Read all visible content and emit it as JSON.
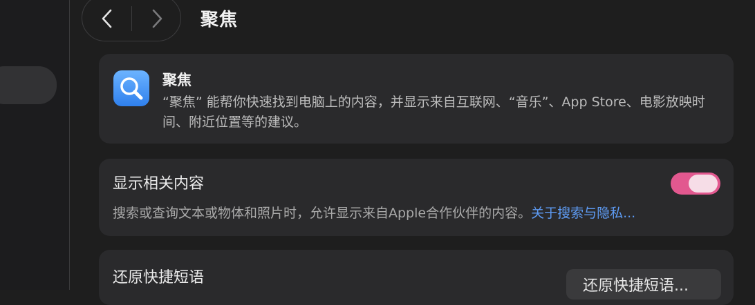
{
  "colors": {
    "accent_pink": "#e2588f",
    "link_blue": "#5e9cf5",
    "app_icon_blue": "#2f80ed"
  },
  "toolbar": {
    "title": "聚焦",
    "back_icon": "chevron-left",
    "forward_icon": "chevron-right"
  },
  "intro": {
    "icon": "spotlight-magnifier-icon",
    "title": "聚焦",
    "description": "“聚焦” 能帮你快速找到电脑上的内容，并显示来自互联网、“音乐”、App Store、电影放映时间、附近位置等的建议。"
  },
  "related_content": {
    "label": "显示相关内容",
    "toggle_on": true,
    "description": "搜索或查询文本或物体和照片时，允许显示来自Apple合作伙伴的内容。",
    "link": "关于搜索与隐私..."
  },
  "restore_shortcuts": {
    "label": "还原快捷短语",
    "button": "还原快捷短语..."
  }
}
